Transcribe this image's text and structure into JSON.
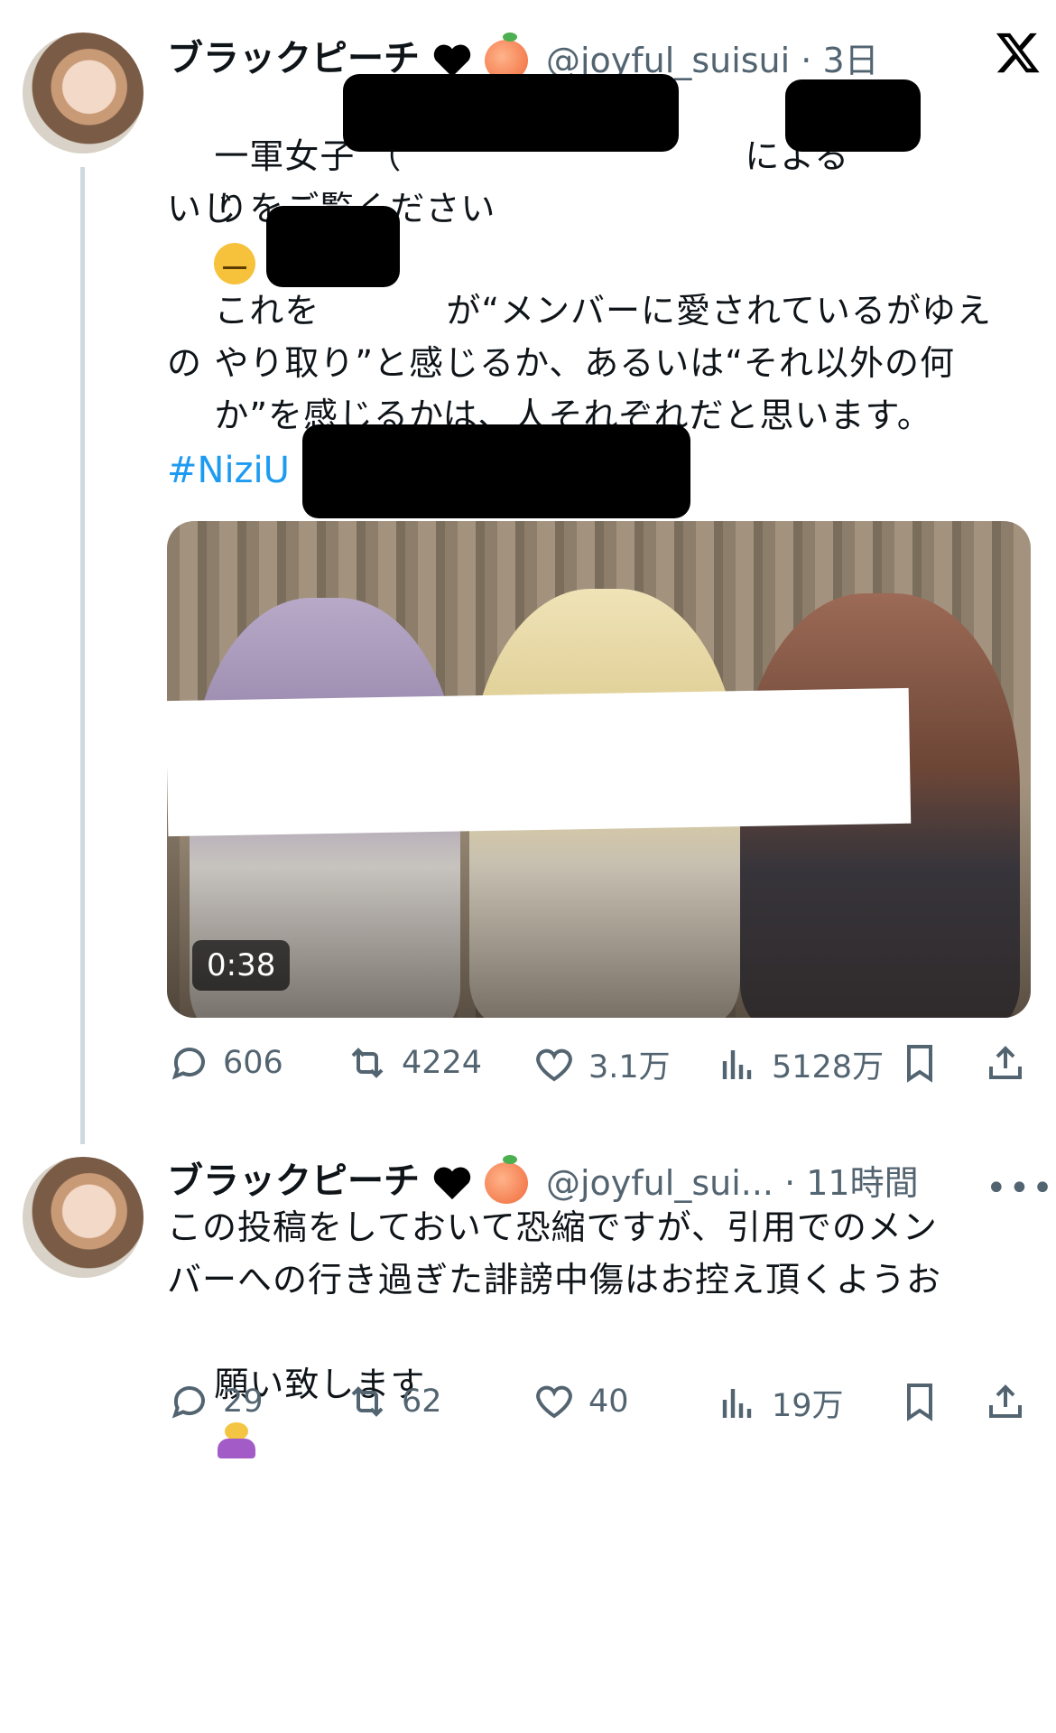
{
  "tweets": [
    {
      "display_name": "ブラックピーチ",
      "handle": "@joyful_suisui",
      "time": "· 3日",
      "text_line1": "一軍女子 （",
      "text_line1_end": "による",
      "text_line1_tail": "いじ",
      "text_line2": "りをご覧ください",
      "text_para2_a": "これを",
      "text_para2_b": "が“メンバーに愛されているがゆえの",
      "text_para2_c": "やり取り”と感じるか、あるいは“それ以外の何",
      "text_para2_d": "か”を感じるかは、人それぞれだと思います。",
      "hashtag": "#NiziU",
      "video_duration": "0:38",
      "stats": {
        "replies": "606",
        "retweets": "4224",
        "likes": "3.1万",
        "views": "5128万"
      }
    },
    {
      "display_name": "ブラックピーチ",
      "handle": "@joyful_sui...",
      "time": "· 11時間",
      "more": "•••",
      "text_line1": "この投稿をしておいて恐縮ですが、引用でのメン",
      "text_line2": "バーへの行き過ぎた誹謗中傷はお控え頂くようお",
      "text_line3": "願い致します",
      "stats": {
        "replies": "29",
        "retweets": "62",
        "likes": "40",
        "views": "19万"
      }
    }
  ],
  "icons": {
    "reply": "reply-icon",
    "retweet": "retweet-icon",
    "like": "heart-icon",
    "views": "views-icon",
    "bookmark": "bookmark-icon",
    "share": "share-icon",
    "brand": "x-logo-icon"
  },
  "colors": {
    "hashtag": "#1d9bf0",
    "secondary_text": "#536471",
    "primary_text": "#0f1419",
    "thread_line": "#cfd9de"
  }
}
